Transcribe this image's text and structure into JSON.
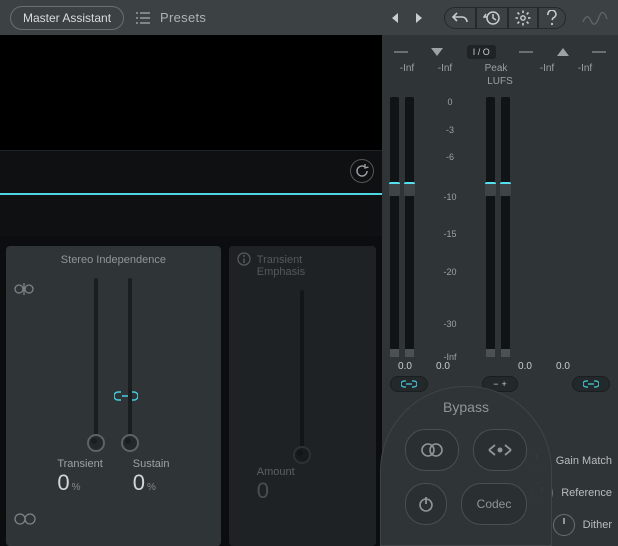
{
  "header": {
    "master_assistant": "Master Assistant",
    "presets_label": "Presets"
  },
  "stereo_panel": {
    "title": "Stereo Independence",
    "transient_label": "Transient",
    "transient_value": "0",
    "sustain_label": "Sustain",
    "sustain_value": "0",
    "unit": "%"
  },
  "transient_panel": {
    "title_line1": "Transient",
    "title_line2": "Emphasis",
    "amount_label": "Amount",
    "amount_value": "0"
  },
  "levels": {
    "io_label": "I / O",
    "peak_label": "Peak",
    "lufs_label": "LUFS",
    "inf": "-Inf",
    "scale": [
      "0",
      "-3",
      "-6",
      "-10",
      "-15",
      "-20",
      "-30",
      "-Inf"
    ],
    "gain_in_l": "0.0",
    "gain_in_r": "0.0",
    "gain_out_l": "0.0",
    "gain_out_r": "0.0",
    "minus": "−",
    "plus": "+"
  },
  "options": {
    "gain_match": "Gain Match",
    "reference": "Reference",
    "dither": "Dither"
  },
  "bypass": {
    "label": "Bypass",
    "codec": "Codec"
  },
  "icons": {
    "preset_list": "preset-list-icon",
    "prev": "prev-icon",
    "next": "next-icon",
    "undo": "undo-icon",
    "history": "history-icon",
    "settings": "gear-icon",
    "help": "help-icon",
    "wave": "wave-icon",
    "refresh": "refresh-icon",
    "stereo": "stereo-field-icon",
    "link": "link-icon",
    "eye": "view-icon",
    "info": "info-icon",
    "link_small": "input-link-icon",
    "sum": "sum-icon",
    "link_out": "output-link-icon",
    "stereo_round": "stereo-round-icon",
    "swap": "swap-icon",
    "power": "power-icon"
  }
}
